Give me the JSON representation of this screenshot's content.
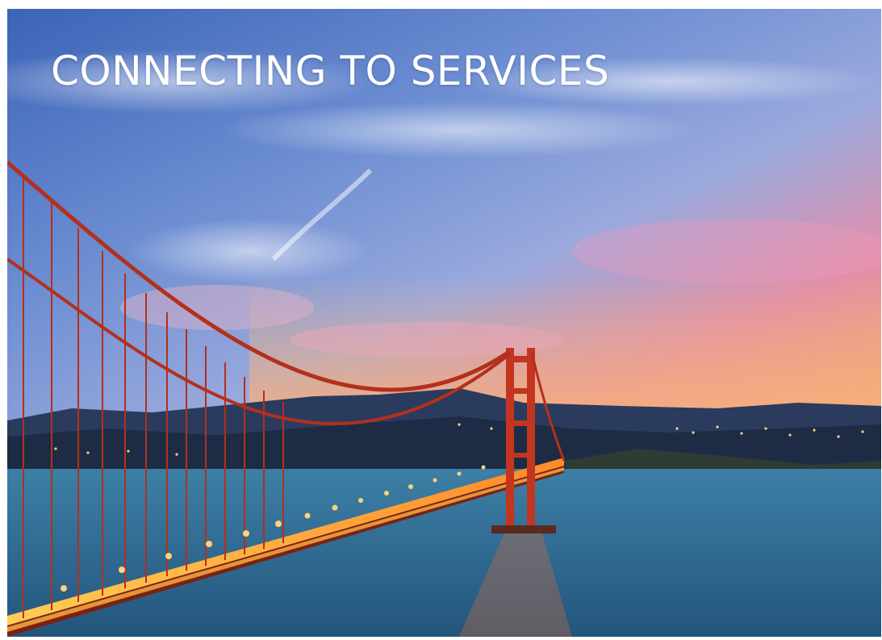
{
  "hero": {
    "title": "CONNECTING TO SERVICES",
    "image_description_icon": "golden-gate-bridge-sunset-photo"
  },
  "colors": {
    "sky_top": "#3f66b8",
    "sky_mid": "#8aa7dc",
    "sunset_pink": "#e78aa6",
    "sunset_orange": "#f2a46a",
    "bridge_red": "#c2361f",
    "water": "#2f6f95",
    "title_text": "#ffffff"
  }
}
